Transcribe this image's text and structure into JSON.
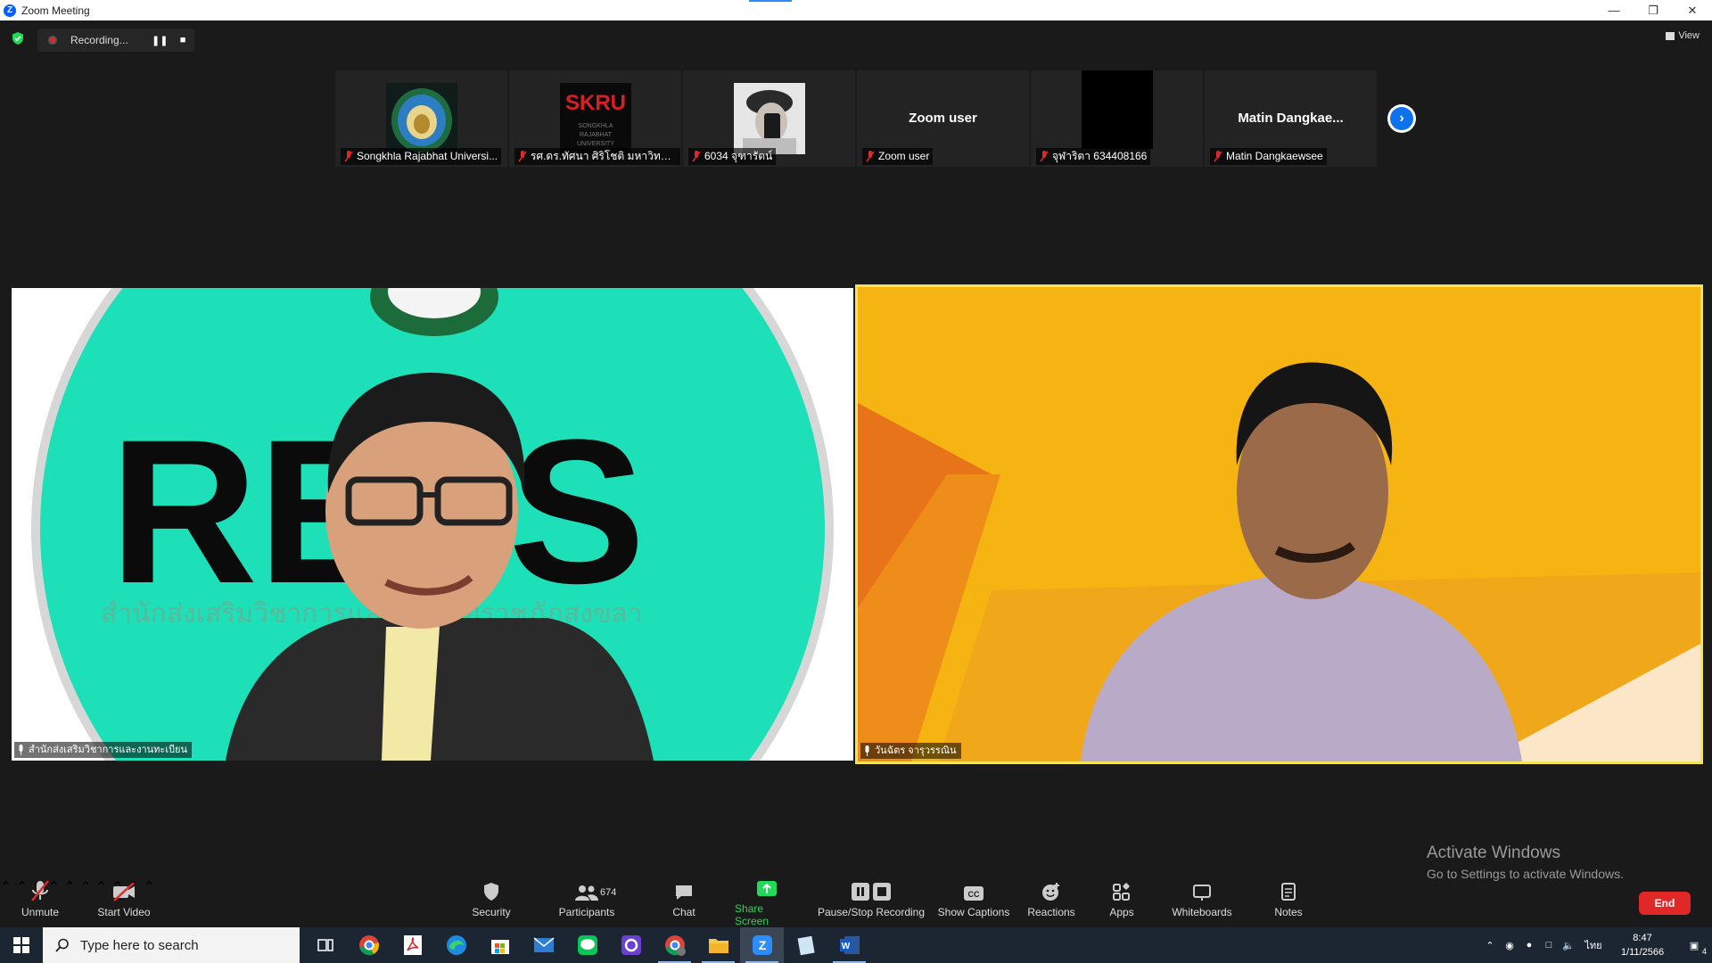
{
  "window": {
    "title": "Zoom Meeting",
    "app_icon": "zoom-logo-icon"
  },
  "window_controls": [
    "minimize",
    "restore",
    "close"
  ],
  "recording": {
    "status": "Recording...",
    "pause_icon": "pause-icon",
    "stop_icon": "stop-icon"
  },
  "view_button": {
    "label": "View"
  },
  "gallery": [
    {
      "name": "Songkhla Rajabhat Universi...",
      "muted": true,
      "picture": "university-seal"
    },
    {
      "name": "รศ.ดร.ทัศนา ศิริโชติ มหาวิทยาล...",
      "muted": true,
      "picture": "skru-logo"
    },
    {
      "name": "6034 จุฑารัตน์",
      "muted": true,
      "picture": "profile-photo"
    },
    {
      "name": "Zoom user",
      "big_name": "Zoom user",
      "muted": true
    },
    {
      "name": "จุฬาริตา 634408166",
      "muted": true,
      "picture": "black-video"
    },
    {
      "name": "Matin Dangkaewsee",
      "big_name": "Matin  Dangkae...",
      "muted": true
    }
  ],
  "main_videos": [
    {
      "name": "สำนักส่งเสริมวิชาการและงานทะเบียน",
      "banner": "RE IS",
      "subtitle": "สำนักส่งเสริมวิชาการและ...ยาลัยราชภัฏสงขลา",
      "active_speaker": false
    },
    {
      "name": "วันฉัตร จารุวรรณิน",
      "active_speaker": true
    }
  ],
  "activation": {
    "title": "Activate Windows",
    "subtitle": "Go to Settings to activate Windows."
  },
  "toolbar": {
    "unmute": "Unmute",
    "start_video": "Start Video",
    "security": "Security",
    "participants": "Participants",
    "participant_count": "674",
    "chat": "Chat",
    "share_screen": "Share Screen",
    "pause_stop_recording": "Pause/Stop Recording",
    "show_captions": "Show Captions",
    "reactions": "Reactions",
    "apps": "Apps",
    "whiteboards": "Whiteboards",
    "notes": "Notes",
    "end": "End"
  },
  "taskbar": {
    "search_placeholder": "Type here to search",
    "apps": [
      "task-view",
      "chrome",
      "acrobat",
      "edge",
      "store",
      "mail",
      "line",
      "app-purple",
      "chrome-profile",
      "file-explorer",
      "zoom",
      "notepad",
      "word"
    ],
    "tray_lang": "ไทย",
    "time": "8:47",
    "date": "1/11/2566",
    "notification_count": "4"
  },
  "colors": {
    "accent_blue": "#0e72ed",
    "active_speaker": "#f2e35a",
    "end_red": "#e02828",
    "share_green": "#23d959"
  }
}
